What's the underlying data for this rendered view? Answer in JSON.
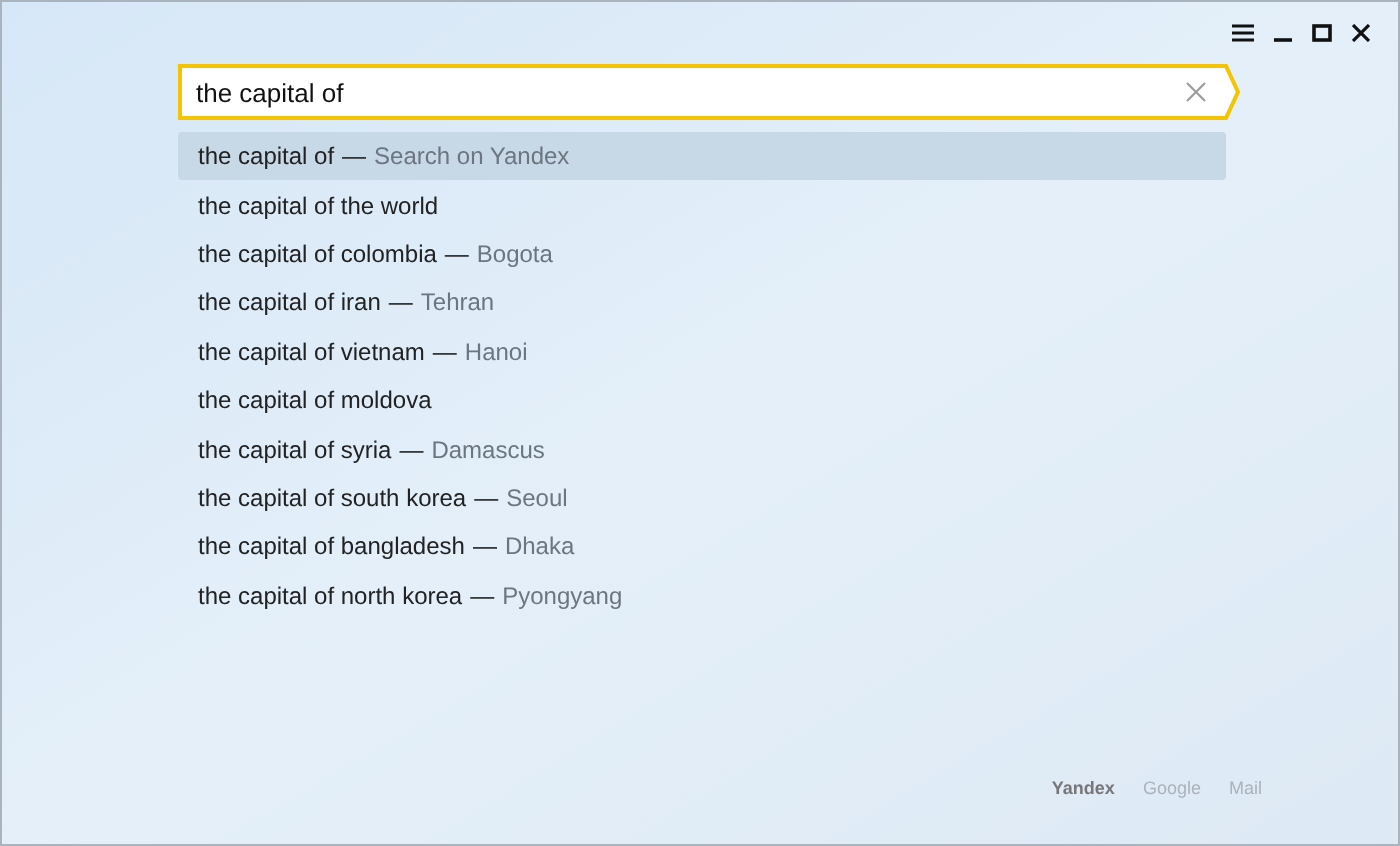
{
  "search": {
    "value": "the capital of"
  },
  "suggestions": [
    {
      "query": "the capital of",
      "separator": "—",
      "hint": "Search on Yandex",
      "selected": true
    },
    {
      "query": "the capital of the world",
      "selected": false
    },
    {
      "query": "the capital of colombia",
      "separator": "—",
      "hint": "Bogota",
      "selected": false
    },
    {
      "query": "the capital of iran",
      "separator": "—",
      "hint": "Tehran",
      "selected": false
    },
    {
      "query": "the capital of vietnam",
      "separator": "—",
      "hint": "Hanoi",
      "selected": false
    },
    {
      "query": "the capital of moldova",
      "selected": false
    },
    {
      "query": "the capital of syria",
      "separator": "—",
      "hint": "Damascus",
      "selected": false
    },
    {
      "query": "the capital of south korea",
      "separator": "—",
      "hint": "Seoul",
      "selected": false
    },
    {
      "query": "the capital of bangladesh",
      "separator": "—",
      "hint": "Dhaka",
      "selected": false
    },
    {
      "query": "the capital of north korea",
      "separator": "—",
      "hint": "Pyongyang",
      "selected": false
    }
  ],
  "engines": [
    {
      "label": "Yandex",
      "selected": true
    },
    {
      "label": "Google",
      "selected": false
    },
    {
      "label": "Mail",
      "selected": false
    }
  ]
}
